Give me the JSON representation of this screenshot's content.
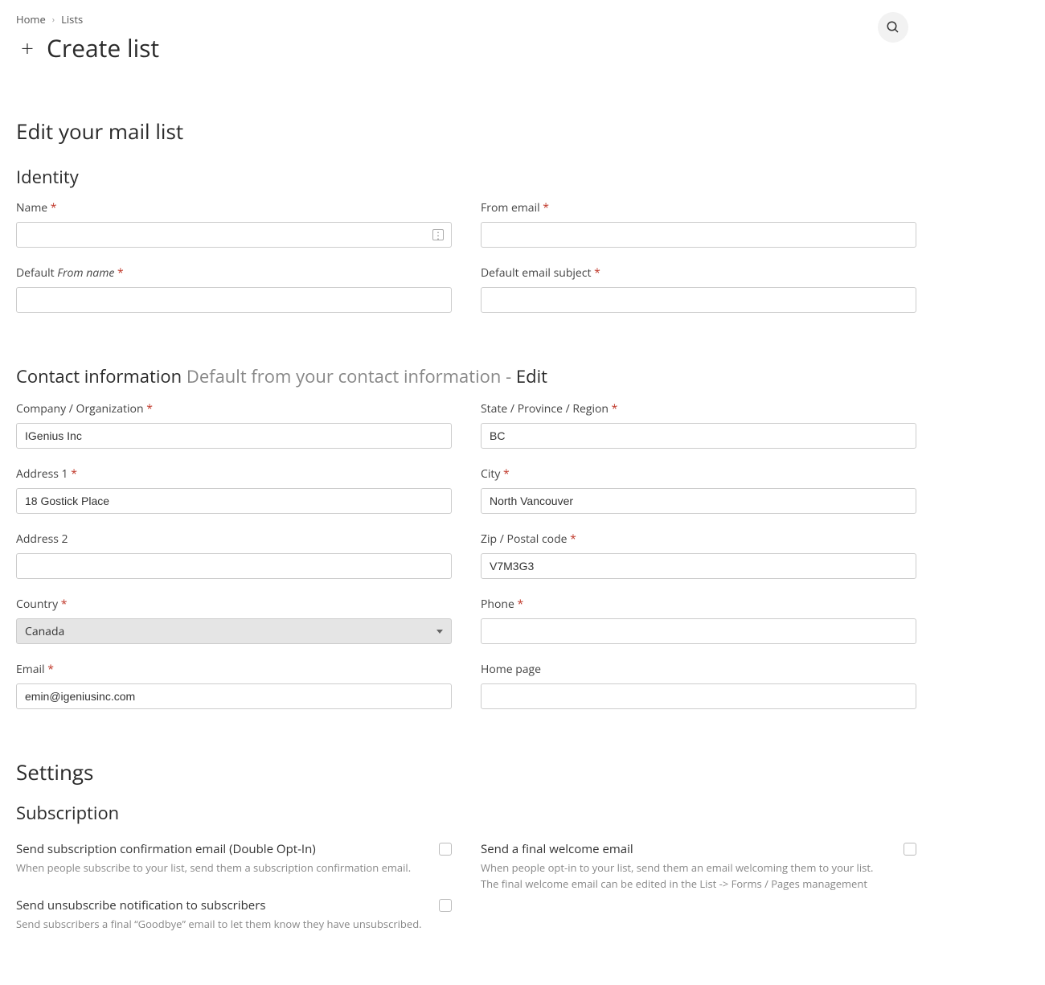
{
  "breadcrumb": {
    "home": "Home",
    "lists": "Lists"
  },
  "header": {
    "title": "Create list"
  },
  "sections": {
    "edit_title": "Edit your mail list",
    "identity_title": "Identity",
    "contact_title": "Contact information",
    "contact_subtitle": "Default from your contact information -",
    "contact_edit": "Edit",
    "settings_title": "Settings",
    "subscription_title": "Subscription"
  },
  "identity": {
    "name_label": "Name",
    "name_value": "",
    "from_email_label": "From email",
    "from_email_value": "",
    "default_from_prefix": "Default",
    "default_from_italic": "From name",
    "default_from_value": "",
    "default_subject_label": "Default email subject",
    "default_subject_value": ""
  },
  "contact": {
    "company_label": "Company / Organization",
    "company_value": "IGenius Inc",
    "state_label": "State / Province / Region",
    "state_value": "BC",
    "address1_label": "Address 1",
    "address1_value": "18 Gostick Place",
    "city_label": "City",
    "city_value": "North Vancouver",
    "address2_label": "Address 2",
    "address2_value": "",
    "zip_label": "Zip / Postal code",
    "zip_value": "V7M3G3",
    "country_label": "Country",
    "country_value": "Canada",
    "phone_label": "Phone",
    "phone_value": "",
    "email_label": "Email",
    "email_value": "emin@igeniusinc.com",
    "homepage_label": "Home page",
    "homepage_value": ""
  },
  "settings": {
    "confirm_title": "Send subscription confirmation email (Double Opt-In)",
    "confirm_desc": "When people subscribe to your list, send them a subscription confirmation email.",
    "welcome_title": "Send a final welcome email",
    "welcome_desc": "When people opt-in to your list, send them an email welcoming them to your list. The final welcome email can be edited in the List -> Forms / Pages management",
    "unsubscribe_title": "Send unsubscribe notification to subscribers",
    "unsubscribe_desc": "Send subscribers a final “Goodbye” email to let them know they have unsubscribed."
  }
}
